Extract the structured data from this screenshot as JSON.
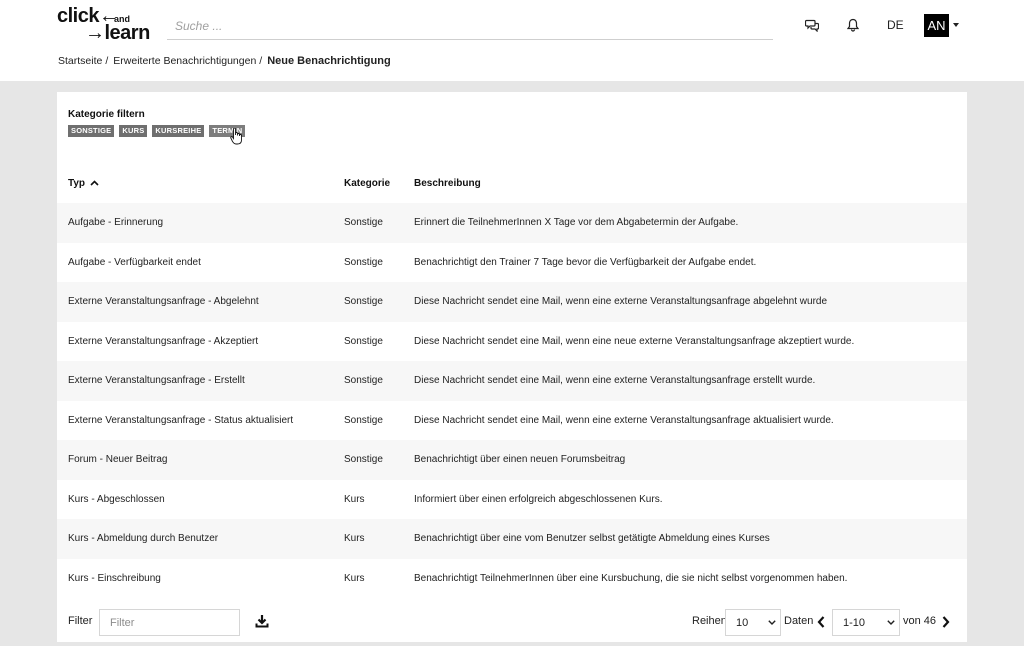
{
  "header": {
    "logo": {
      "line1": "click",
      "and": "and",
      "line2": "learn"
    },
    "search_placeholder": "Suche ...",
    "chat_icon": "chat-bubbles-icon",
    "bell_icon": "bell-icon",
    "language": "DE",
    "user_initials": "AN"
  },
  "breadcrumb": {
    "items": [
      "Startseite",
      "Erweiterte Benachrichtigungen"
    ],
    "separator": "/",
    "current": "Neue Benachrichtigung"
  },
  "filters": {
    "title": "Kategorie filtern",
    "chips": [
      "SONSTIGE",
      "KURS",
      "KURSREIHE",
      "TERMIN"
    ]
  },
  "table": {
    "columns": [
      "Typ",
      "Kategorie",
      "Beschreibung"
    ],
    "sort": {
      "column": "Typ",
      "direction": "ascending"
    },
    "rows": [
      [
        "Aufgabe - Erinnerung",
        "Sonstige",
        "Erinnert die TeilnehmerInnen X Tage vor dem Abgabetermin der Aufgabe."
      ],
      [
        "Aufgabe - Verfügbarkeit endet",
        "Sonstige",
        "Benachrichtigt den Trainer 7 Tage bevor die Verfügbarkeit der Aufgabe endet."
      ],
      [
        "Externe Veranstaltungsanfrage - Abgelehnt",
        "Sonstige",
        "Diese Nachricht sendet eine Mail, wenn eine externe Veranstaltungsanfrage abgelehnt wurde"
      ],
      [
        "Externe Veranstaltungsanfrage - Akzeptiert",
        "Sonstige",
        "Diese Nachricht sendet eine Mail, wenn eine neue externe Veranstaltungsanfrage akzeptiert wurde."
      ],
      [
        "Externe Veranstaltungsanfrage - Erstellt",
        "Sonstige",
        "Diese Nachricht sendet eine Mail, wenn eine externe Veranstaltungsanfrage erstellt wurde."
      ],
      [
        "Externe Veranstaltungsanfrage - Status aktualisiert",
        "Sonstige",
        "Diese Nachricht sendet eine Mail, wenn eine externe Veranstaltungsanfrage aktualisiert wurde."
      ],
      [
        "Forum - Neuer Beitrag",
        "Sonstige",
        "Benachrichtigt über einen neuen Forumsbeitrag"
      ],
      [
        "Kurs - Abgeschlossen",
        "Kurs",
        "Informiert über einen erfolgreich abgeschlossenen Kurs."
      ],
      [
        "Kurs - Abmeldung durch Benutzer",
        "Kurs",
        "Benachrichtigt über eine vom Benutzer selbst getätigte Abmeldung eines Kurses"
      ],
      [
        "Kurs - Einschreibung",
        "Kurs",
        "Benachrichtigt TeilnehmerInnen über eine Kursbuchung, die sie nicht selbst vorgenommen haben."
      ]
    ]
  },
  "footer": {
    "filter_label": "Filter",
    "filter_placeholder": "Filter",
    "rows_label": "Reihen",
    "rows_value": "10",
    "data_label": "Daten",
    "range_value": "1-10",
    "total_label": "von 46"
  }
}
